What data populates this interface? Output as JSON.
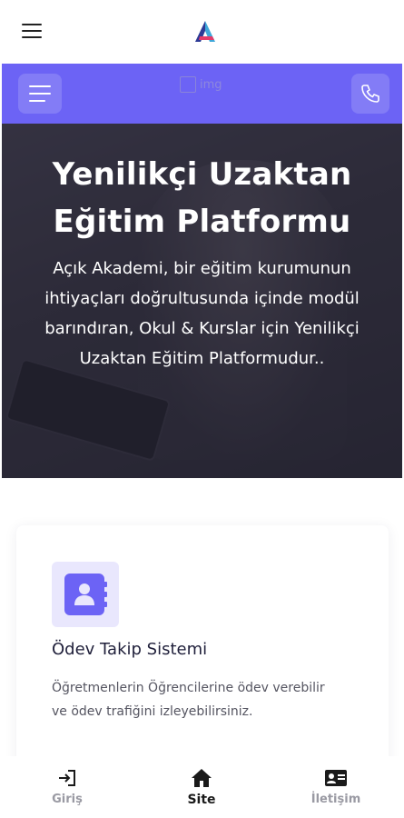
{
  "appbar": {
    "menu_icon": "hamburger-icon",
    "logo": "app-logo",
    "logo_colors": [
      "#2d3b96",
      "#3fa7d9",
      "#e23c6a"
    ]
  },
  "site_header": {
    "background": "#6c63f5",
    "menu_icon": "menu-lines-icon",
    "image_alt": "img",
    "phone_icon": "phone-icon"
  },
  "hero": {
    "title": "Yenilikçi Uzaktan Eğitim Platformu",
    "title_lines": [
      "Yenilikçi Uzaktan",
      "Eğitim Platformu"
    ],
    "subtitle_lines": [
      "Açık Akademi, bir eğitim kurumunun",
      "ihtiyaçları doğrultusunda içinde modül",
      "barındıran, Okul & Kurslar için Yenilikçi",
      "Uzaktan Eğitim Platformudur.."
    ]
  },
  "card": {
    "icon": "contact-book-icon",
    "title": "Ödev Takip Sistemi",
    "description_lines": [
      "Öğretmenlerin Öğrencilerine ödev verebilir",
      "ve ödev trafiğini izleyebilirsiniz."
    ]
  },
  "bottom_nav": {
    "items": [
      {
        "label": "Giriş",
        "icon": "login-icon",
        "active": false
      },
      {
        "label": "Site",
        "icon": "home-icon",
        "active": true
      },
      {
        "label": "İletişim",
        "icon": "contact-card-icon",
        "active": false
      }
    ]
  }
}
